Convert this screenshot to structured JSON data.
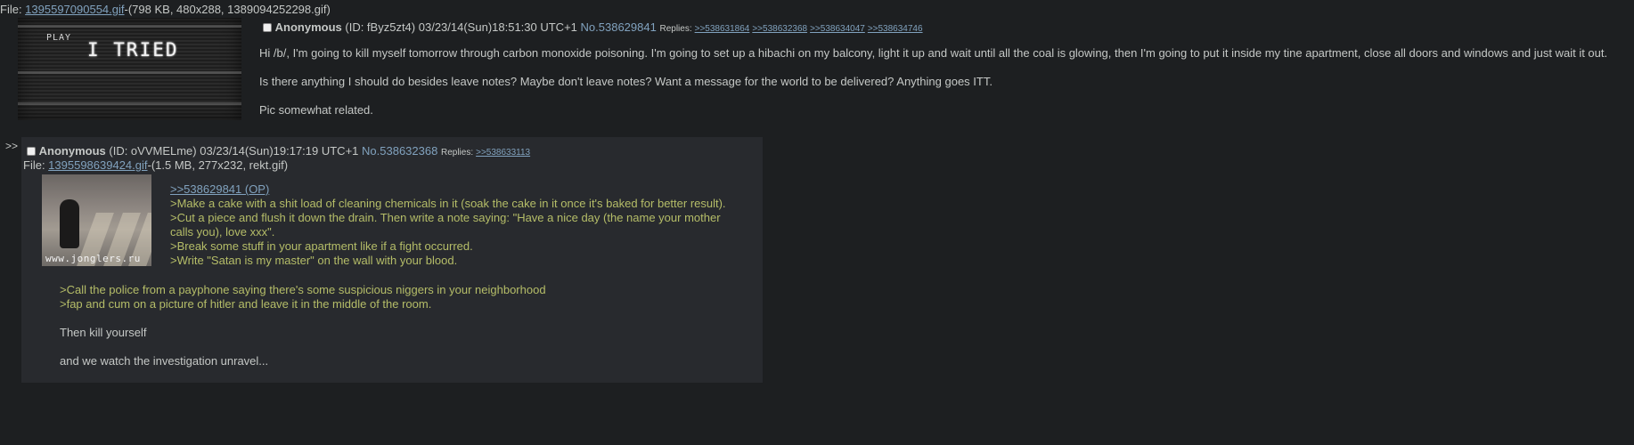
{
  "op": {
    "file_label": "File: ",
    "file_name": "1395597090554.gif",
    "file_info": "-(798 KB, 480x288, 1389094252298.gif)",
    "thumb": {
      "play_text": "PLAY",
      "caption": "I TRIED"
    },
    "name": "Anonymous",
    "id_text": "(ID: fByz5zt4)",
    "date": "03/23/14(Sun)18:51:30 UTC+1",
    "post_no": "No.538629841",
    "replies_label": "Replies:",
    "replies": [
      ">>538631864",
      ">>538632368",
      ">>538634047",
      ">>538634746"
    ],
    "body": [
      "Hi /b/, I'm going to kill myself tomorrow through carbon monoxide poisoning. I'm going to set up a hibachi on my balcony, light it up and wait until all the coal is glowing, then I'm going to put it inside my tine apartment, close all doors and windows and just wait it out.",
      "Is there anything I should do besides leave notes? Maybe don't leave notes? Want a message for the world to be delivered? Anything goes ITT.",
      "Pic somewhat related."
    ]
  },
  "reply": {
    "arrows": ">>",
    "name": "Anonymous",
    "id_text": "(ID: oVVMELme)",
    "date": "03/23/14(Sun)19:17:19 UTC+1",
    "post_no": "No.538632368",
    "replies_label": "Replies:",
    "replies": [
      ">>538633113"
    ],
    "file_label": "File: ",
    "file_name": "1395598639424.gif",
    "file_info": "-(1.5 MB, 277x232, rekt.gif)",
    "thumb_watermark": "www.jonglers.ru",
    "op_link": ">>538629841 (OP)",
    "quotes_beside_image": [
      ">Make a cake with a shit load of cleaning chemicals in it (soak the cake in it once it's baked for better result).",
      ">Cut a piece and flush it down the drain. Then write a note saying: \"Have a nice day (the name your mother calls you), love xxx\".",
      ">Break some stuff in your apartment like if a fight occurred.",
      ">Write \"Satan is my master\" on the wall with your blood."
    ],
    "quotes_below": [
      ">Call the police from a payphone saying there's some suspicious niggers in your neighborhood",
      ">fap and cum on a picture of hitler and leave it in the middle of the room."
    ],
    "closing": [
      "Then kill yourself",
      "and we watch the investigation unravel..."
    ]
  }
}
